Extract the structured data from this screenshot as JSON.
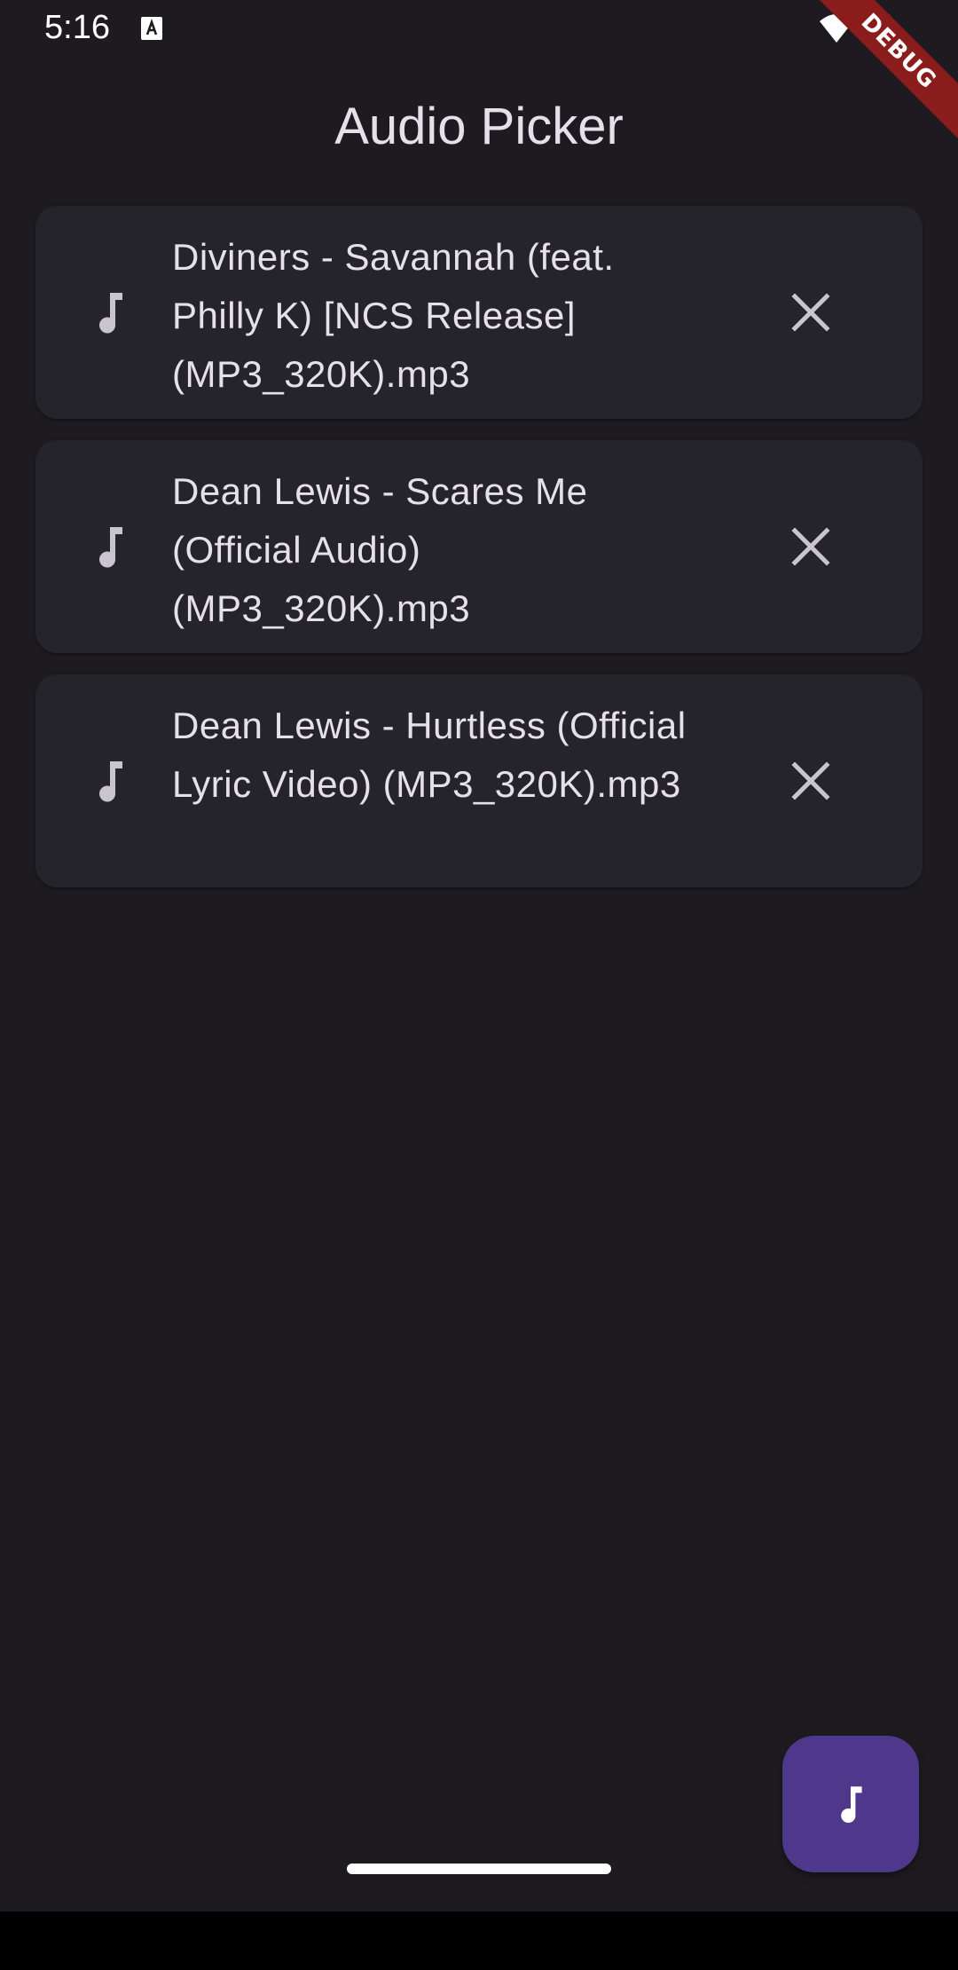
{
  "status_bar": {
    "time": "5:16",
    "icons": [
      "notification-a-icon",
      "wifi-icon",
      "battery-icon"
    ]
  },
  "debug_banner": {
    "label": "DEBUG"
  },
  "app_bar": {
    "title": "Audio Picker"
  },
  "audio_list": {
    "items": [
      {
        "title": "Diviners - Savannah (feat. Philly K) [NCS Release] (MP3_320K).mp3",
        "icon": "music-note-icon",
        "action_icon": "close-icon"
      },
      {
        "title": "Dean Lewis - Scares Me (Official Audio) (MP3_320K).mp3",
        "icon": "music-note-icon",
        "action_icon": "close-icon"
      },
      {
        "title": "Dean Lewis - Hurtless (Official Lyric Video) (MP3_320K).mp3",
        "icon": "music-note-icon",
        "action_icon": "close-icon"
      }
    ]
  },
  "fab": {
    "icon": "music-note-icon"
  },
  "colors": {
    "background": "#1d1b20",
    "card": "#26242b",
    "text": "#e6e0e9",
    "icon": "#cac4d0",
    "fab": "#4f378b",
    "debug_banner": "#8b1c1c"
  }
}
